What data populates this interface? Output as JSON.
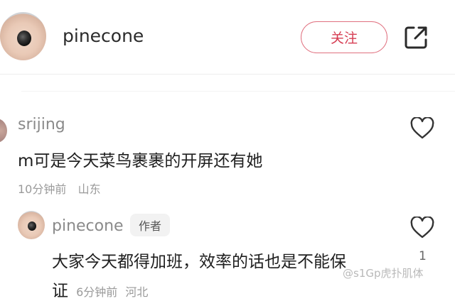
{
  "header": {
    "username": "pinecone",
    "follow_label": "关注",
    "share_icon": "share-out-icon"
  },
  "comments": [
    {
      "username": "srijing",
      "text": "m可是今天菜鸟裹裹的开屏还有她",
      "time": "10分钟前",
      "location": "山东",
      "like_icon": "heart-outline-icon"
    }
  ],
  "reply": {
    "username": "pinecone",
    "author_tag": "作者",
    "text_line1": "大家今天都得加班，效率的话也是不能保",
    "text_line2_start": "证",
    "time": "6分钟前",
    "location": "河北",
    "like_count": "1",
    "like_icon": "heart-outline-icon"
  },
  "watermark": "@s1Gp虎扑肌体"
}
